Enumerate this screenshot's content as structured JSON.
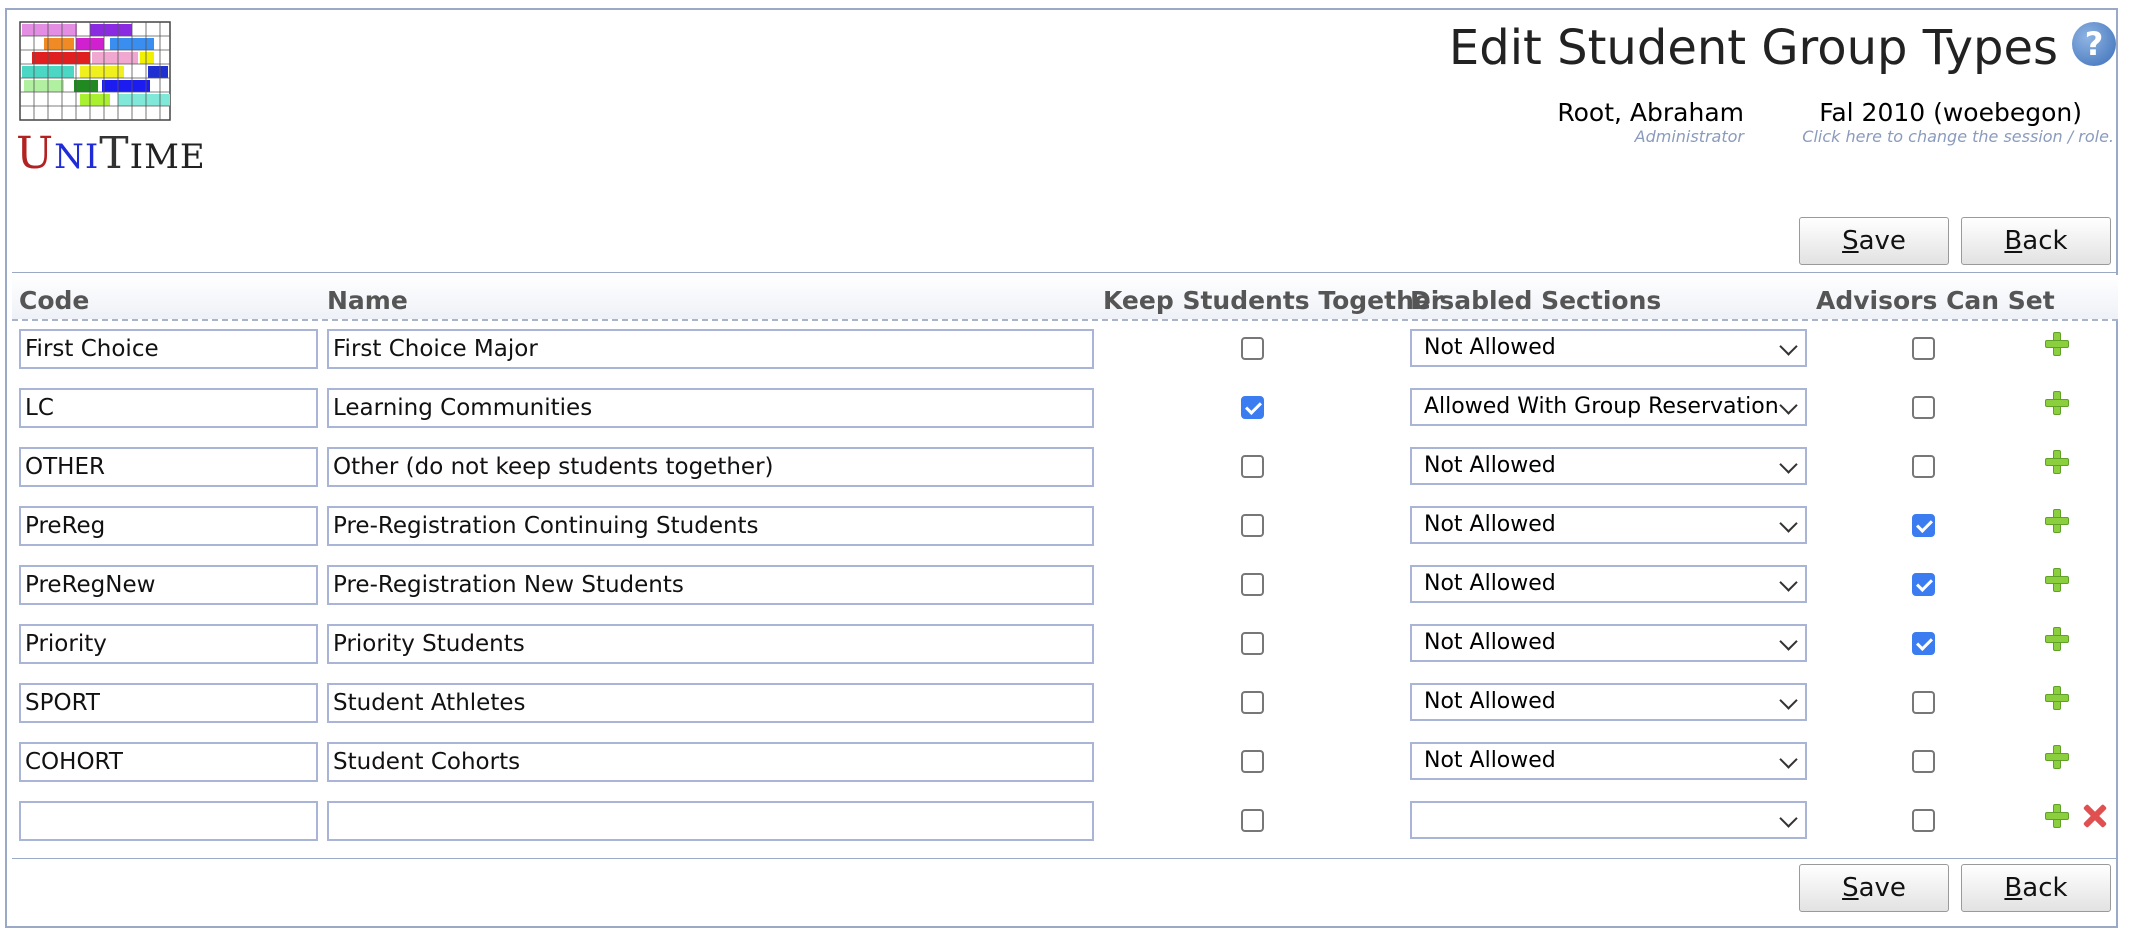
{
  "header": {
    "title": "Edit Student Group Types",
    "help_icon": "?",
    "user_name": "Root, Abraham",
    "user_role": "Administrator",
    "session_name": "Fal 2010 (woebegon)",
    "session_hint": "Click here to change the session / role."
  },
  "logo": {
    "text_u": "U",
    "text_ni": "NI",
    "text_t": "T",
    "text_ime": "IME"
  },
  "buttons": {
    "save_first": "S",
    "save_rest": "ave",
    "back_first": "B",
    "back_rest": "ack"
  },
  "table": {
    "columns": {
      "code": "Code",
      "name": "Name",
      "keep": "Keep Students Together",
      "disabled": "Disabled Sections",
      "advisors": "Advisors Can Set"
    },
    "rows": [
      {
        "code": "First Choice",
        "name": "First Choice Major",
        "keep": false,
        "disabled": "Not Allowed",
        "advisors": false
      },
      {
        "code": "LC",
        "name": "Learning Communities",
        "keep": true,
        "disabled": "Allowed With Group Reservation",
        "advisors": false
      },
      {
        "code": "OTHER",
        "name": "Other (do not keep students together)",
        "keep": false,
        "disabled": "Not Allowed",
        "advisors": false
      },
      {
        "code": "PreReg",
        "name": "Pre-Registration Continuing Students",
        "keep": false,
        "disabled": "Not Allowed",
        "advisors": true
      },
      {
        "code": "PreRegNew",
        "name": "Pre-Registration New Students",
        "keep": false,
        "disabled": "Not Allowed",
        "advisors": true
      },
      {
        "code": "Priority",
        "name": "Priority Students",
        "keep": false,
        "disabled": "Not Allowed",
        "advisors": true
      },
      {
        "code": "SPORT",
        "name": "Student Athletes",
        "keep": false,
        "disabled": "Not Allowed",
        "advisors": false
      },
      {
        "code": "COHORT",
        "name": "Student Cohorts",
        "keep": false,
        "disabled": "Not Allowed",
        "advisors": false
      },
      {
        "code": "",
        "name": "",
        "keep": false,
        "disabled": "",
        "advisors": false
      }
    ]
  },
  "colors": {
    "accent": "#3b7cf0",
    "border": "#9aaac6",
    "add": "#8ccf3e",
    "delete": "#e05050"
  }
}
